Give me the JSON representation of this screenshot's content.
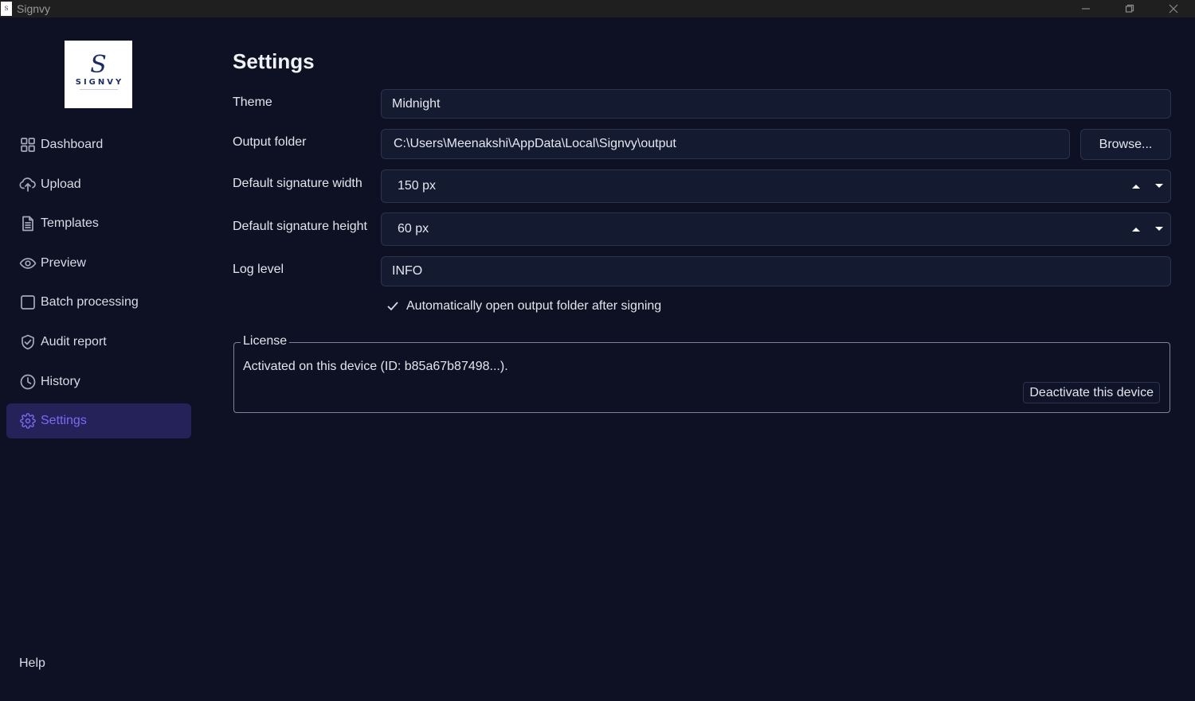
{
  "window": {
    "title": "Signvy",
    "icon_text": "S"
  },
  "logo": {
    "mark": "S",
    "wordmark": "SIGNVY"
  },
  "sidebar": {
    "items": [
      {
        "label": "Dashboard",
        "icon": "dashboard-grid-icon"
      },
      {
        "label": "Upload",
        "icon": "cloud-upload-icon"
      },
      {
        "label": "Templates",
        "icon": "document-icon"
      },
      {
        "label": "Preview",
        "icon": "eye-icon"
      },
      {
        "label": "Batch processing",
        "icon": "square-icon"
      },
      {
        "label": "Audit report",
        "icon": "shield-check-icon"
      },
      {
        "label": "History",
        "icon": "clock-icon"
      },
      {
        "label": "Settings",
        "icon": "gear-icon",
        "active": true
      }
    ],
    "help": "Help",
    "active_color": "#7a6cf2"
  },
  "settings": {
    "title": "Settings",
    "theme": {
      "label": "Theme",
      "value": "Midnight"
    },
    "output_folder": {
      "label": "Output folder",
      "value": "C:\\Users\\Meenakshi\\AppData\\Local\\Signvy\\output",
      "browse_label": "Browse..."
    },
    "sig_width": {
      "label": "Default signature width",
      "value": "150 px"
    },
    "sig_height": {
      "label": "Default signature height",
      "value": "60 px"
    },
    "log_level": {
      "label": "Log level",
      "value": "INFO"
    },
    "auto_open": {
      "label": "Automatically open output folder after signing",
      "checked": true
    }
  },
  "license": {
    "legend": "License",
    "status": "Activated on this device (ID: b85a67b87498...).",
    "deactivate_label": "Deactivate this device"
  }
}
